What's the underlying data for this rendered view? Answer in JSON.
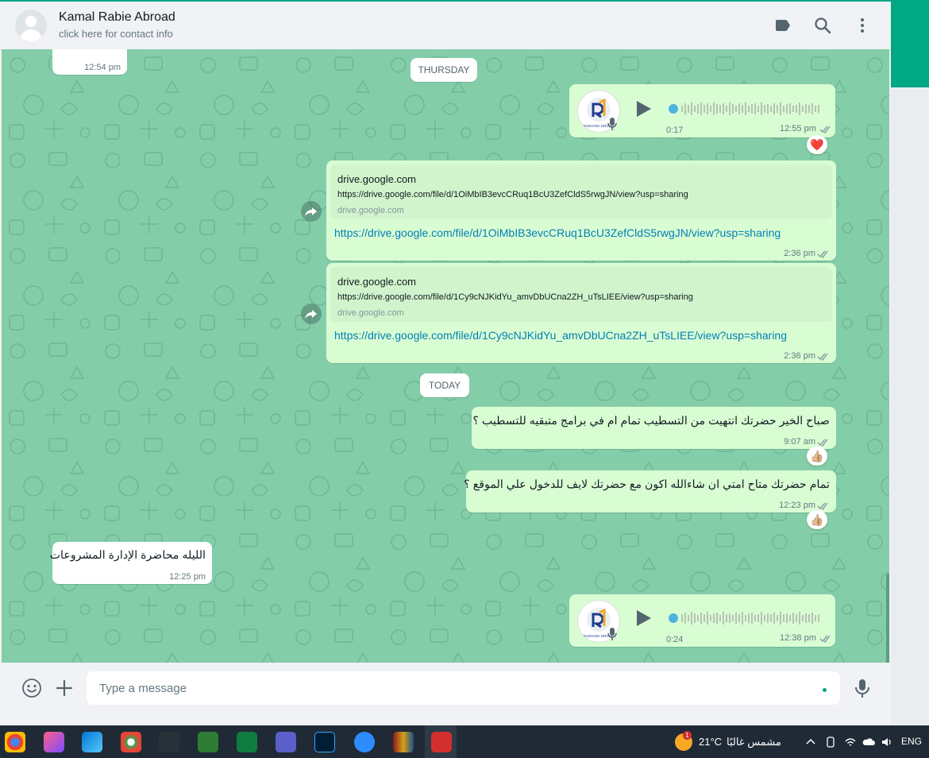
{
  "header": {
    "contact_name": "Kamal Rabie Abroad",
    "contact_sub": "click here for contact info",
    "icons": [
      "label-icon",
      "search-icon",
      "menu-icon"
    ]
  },
  "chat": {
    "top_partial_time": "12:54 pm",
    "day_thursday": "THURSDAY",
    "day_today": "TODAY",
    "voice1": {
      "duration": "0:17",
      "time": "12:55 pm",
      "reaction": "❤️",
      "avatar_text": "RADIANO GROUP"
    },
    "link1": {
      "preview_title": "drive.google.com",
      "preview_desc": "https://drive.google.com/file/d/1OiMbIB3evcCRuq1BcU3ZefCldS5rwgJN/view?usp=sharing",
      "preview_domain": "drive.google.com",
      "link": "https://drive.google.com/file/d/1OiMbIB3evcCRuq1BcU3ZefCldS5rwgJN/view?usp=sharing",
      "time": "2:36 pm"
    },
    "link2": {
      "preview_title": "drive.google.com",
      "preview_desc": "https://drive.google.com/file/d/1Cy9cNJKidYu_amvDbUCna2ZH_uTsLIEE/view?usp=sharing",
      "preview_domain": "drive.google.com",
      "link": "https://drive.google.com/file/d/1Cy9cNJKidYu_amvDbUCna2ZH_uTsLIEE/view?usp=sharing",
      "time": "2:36 pm"
    },
    "msg1": {
      "text": "صباح الخير حضرتك انتهيت من التسطيب تمام ام في برامج متبقيه للتسطيب ؟",
      "time": "9:07 am",
      "reaction": "👍🏼"
    },
    "msg2": {
      "text": "تمام حضرتك متاح امتي ان شاءالله اكون مع حضرتك لايف للدخول علي الموقع ؟",
      "time": "12:23 pm",
      "reaction": "👍🏼"
    },
    "msg_in": {
      "text": "الليله محاضرة الإدارة المشروعات",
      "time": "12:25 pm"
    },
    "voice2": {
      "duration": "0:24",
      "time": "12:38 pm",
      "avatar_text": "RADIANO GROUP"
    }
  },
  "footer": {
    "placeholder": "Type a message"
  },
  "taskbar": {
    "weather_temp": "21°C",
    "weather_text": "مشمس غالبًا",
    "weather_badge": "1",
    "lang": "ENG"
  }
}
